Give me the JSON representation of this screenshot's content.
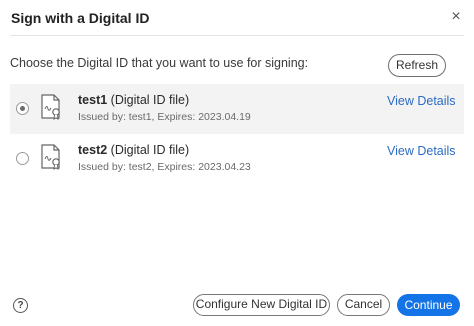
{
  "dialog": {
    "title": "Sign with a Digital ID",
    "close_symbol": "×",
    "prompt": "Choose the Digital ID that you want to use for signing:",
    "refresh_label": "Refresh",
    "help_symbol": "?"
  },
  "ids": [
    {
      "name": "test1",
      "type": " (Digital ID file)",
      "issued": "Issued by: test1, Expires: 2023.04.19",
      "view_label": "View Details",
      "selected": true
    },
    {
      "name": "test2",
      "type": " (Digital ID file)",
      "issued": "Issued by: test2, Expires: 2023.04.23",
      "view_label": "View Details",
      "selected": false
    }
  ],
  "footer": {
    "configure_label": "Configure New Digital ID",
    "cancel_label": "Cancel",
    "continue_label": "Continue"
  },
  "colors": {
    "accent": "#1473e6",
    "link": "#2b6cc4",
    "selected_row": "#f3f3f3"
  },
  "icons": {
    "certificate": "certificate-icon",
    "close": "close-icon",
    "help": "help-icon"
  }
}
